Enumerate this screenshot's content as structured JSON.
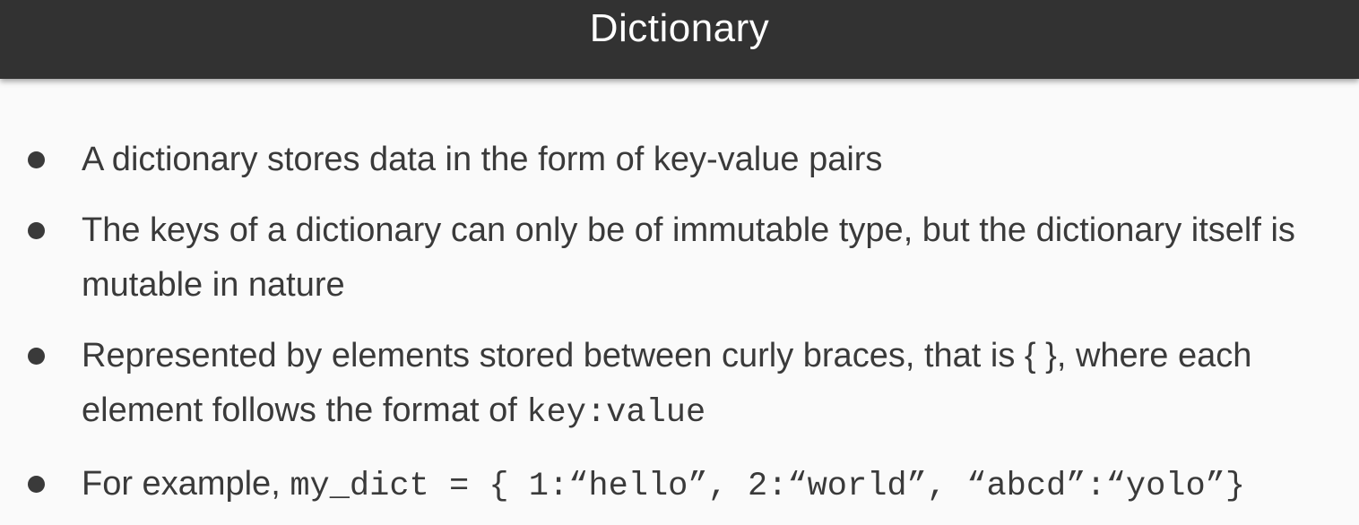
{
  "slide": {
    "title": "Dictionary"
  },
  "bullets": [
    {
      "text": "A dictionary stores data in the form of key-value pairs"
    },
    {
      "text": "The keys of a dictionary can only be of immutable type, but the dictionary itself is mutable in nature"
    },
    {
      "text_before_code": "Represented by elements stored between curly braces, that is { }, where each element follows the format of ",
      "code": "key:value"
    },
    {
      "text_before_code": "For example, ",
      "code": "my_dict = { 1:“hello”, 2:“world”, “abcd”:“yolo”}"
    }
  ]
}
